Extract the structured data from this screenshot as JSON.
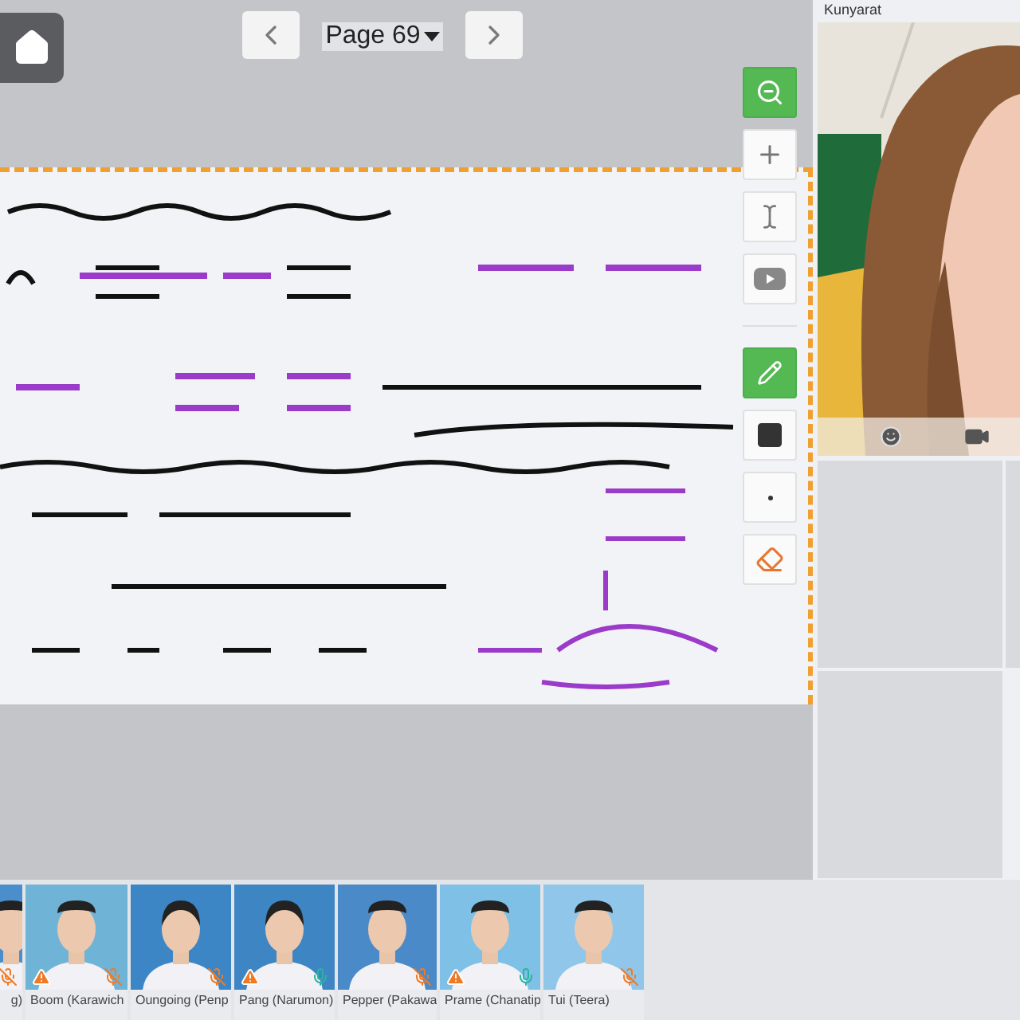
{
  "nav": {
    "page_label": "Page 69"
  },
  "tools": [
    {
      "kind": "zoom-out",
      "selected": true
    },
    {
      "kind": "plus",
      "selected": false
    },
    {
      "kind": "text",
      "selected": false
    },
    {
      "kind": "video",
      "selected": false
    },
    {
      "kind": "divider"
    },
    {
      "kind": "pencil",
      "selected": true
    },
    {
      "kind": "square",
      "selected": false
    },
    {
      "kind": "dot",
      "selected": false
    },
    {
      "kind": "eraser",
      "selected": false
    }
  ],
  "presenter": {
    "name": "Kunyarat"
  },
  "participants": [
    {
      "name": "g)",
      "warning": false,
      "muted": true
    },
    {
      "name": "Boom (Karawich",
      "warning": true,
      "muted": true
    },
    {
      "name": "Oungoing (Penp",
      "warning": false,
      "muted": true
    },
    {
      "name": "Pang (Narumon)",
      "warning": true,
      "muted": false
    },
    {
      "name": "Pepper (Pakawa",
      "warning": false,
      "muted": true
    },
    {
      "name": "Prame (Chanatip",
      "warning": true,
      "muted": false
    },
    {
      "name": "Tui (Teera)",
      "warning": false,
      "muted": true
    }
  ]
}
